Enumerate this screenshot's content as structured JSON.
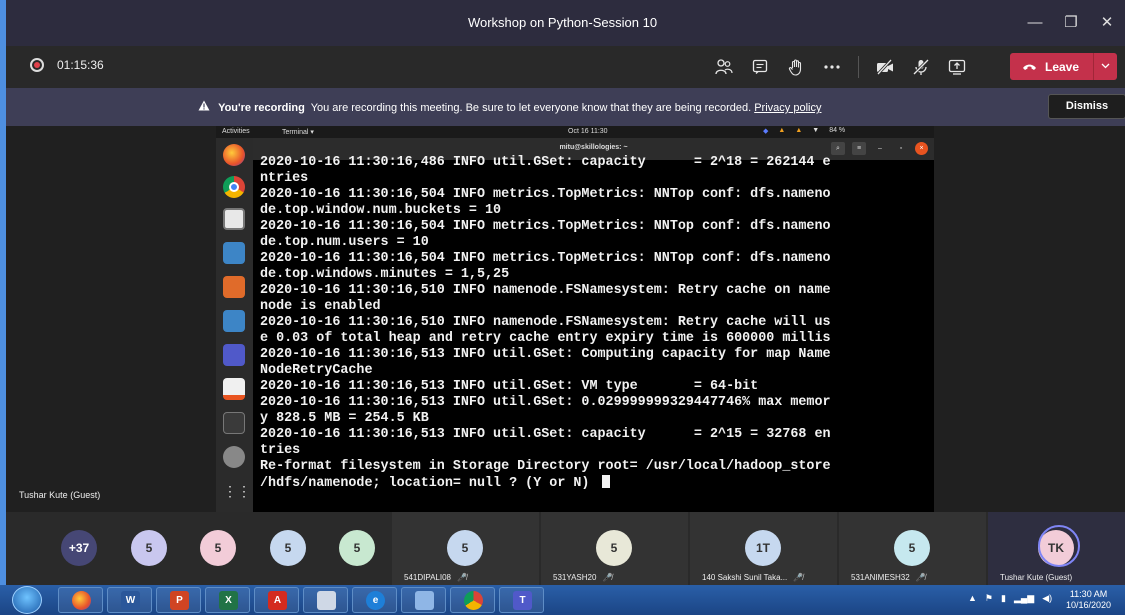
{
  "window": {
    "title": "Workshop on Python-Session 10",
    "minimize_glyph": "—",
    "maximize_glyph": "❐",
    "close_glyph": "✕"
  },
  "toolbar": {
    "timer": "01:15:36",
    "icons": [
      "participants-icon",
      "chat-icon",
      "raise-hand-icon",
      "more-icon",
      "camera-off-icon",
      "mic-off-icon",
      "share-screen-icon"
    ],
    "leave_label": "Leave",
    "leave_color": "#c4314b"
  },
  "banner": {
    "title": "You're recording",
    "message": "You are recording this meeting. Be sure to let everyone know that they are being recorded.",
    "link": "Privacy policy",
    "dismiss_label": "Dismiss"
  },
  "presenter_name": "Tushar Kute (Guest)",
  "desktop": {
    "activities": "Activities",
    "terminal_menu": "Terminal ▾",
    "clock": "Oct 16  11:30",
    "battery": "84 %",
    "terminal_title": "mitu@skillologies: ~"
  },
  "terminal": {
    "lines": [
      "2020-10-16 11:30:16,486 INFO util.GSet: capacity      = 2^18 = 262144 e",
      "ntries",
      "2020-10-16 11:30:16,504 INFO metrics.TopMetrics: NNTop conf: dfs.nameno",
      "de.top.window.num.buckets = 10",
      "2020-10-16 11:30:16,504 INFO metrics.TopMetrics: NNTop conf: dfs.nameno",
      "de.top.num.users = 10",
      "2020-10-16 11:30:16,504 INFO metrics.TopMetrics: NNTop conf: dfs.nameno",
      "de.top.windows.minutes = 1,5,25",
      "2020-10-16 11:30:16,510 INFO namenode.FSNamesystem: Retry cache on name",
      "node is enabled",
      "2020-10-16 11:30:16,510 INFO namenode.FSNamesystem: Retry cache will us",
      "e 0.03 of total heap and retry cache entry expiry time is 600000 millis",
      "2020-10-16 11:30:16,513 INFO util.GSet: Computing capacity for map Name",
      "NodeRetryCache",
      "2020-10-16 11:30:16,513 INFO util.GSet: VM type       = 64-bit",
      "2020-10-16 11:30:16,513 INFO util.GSet: 0.029999999329447746% max memor",
      "y 828.5 MB = 254.5 KB",
      "2020-10-16 11:30:16,513 INFO util.GSet: capacity      = 2^15 = 32768 en",
      "tries",
      "Re-format filesystem in Storage Directory root= /usr/local/hadoop_store",
      "/hdfs/namenode; location= null ? (Y or N) "
    ]
  },
  "participants": {
    "overflow": "+37",
    "avatars": [
      {
        "initials": "5",
        "color": "#c9c7ef"
      },
      {
        "initials": "5",
        "color": "#f2ccd8"
      },
      {
        "initials": "5",
        "color": "#c6d8ef"
      },
      {
        "initials": "5",
        "color": "#c8e8d0"
      }
    ],
    "named": [
      {
        "initials": "5",
        "name": "541DIPALI08",
        "color": "#c6d8ef"
      },
      {
        "initials": "5",
        "name": "531YASH20",
        "color": "#e8e8d8"
      },
      {
        "initials": "1T",
        "name": "140 Sakshi Sunil Taka...",
        "color": "#c6d8ef"
      },
      {
        "initials": "5",
        "name": "531ANIMESH32",
        "color": "#c6e8ef"
      }
    ],
    "self": {
      "initials": "TK",
      "name": "Tushar Kute (Guest)",
      "color": "#f2ccd8"
    }
  },
  "taskbar": {
    "apps": [
      "firefox-icon",
      "word-icon",
      "powerpoint-icon",
      "excel-icon",
      "acrobat-icon",
      "files-icon",
      "ie-icon",
      "paint-icon",
      "chrome-icon",
      "teams-icon"
    ],
    "time": "11:30 AM",
    "date": "10/16/2020"
  }
}
